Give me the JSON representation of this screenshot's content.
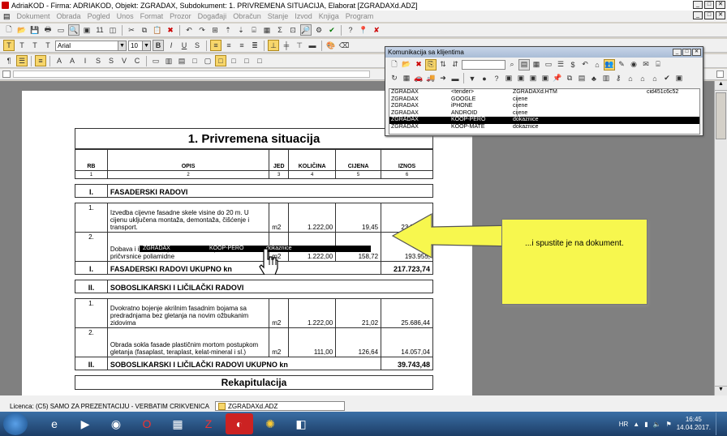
{
  "window": {
    "title": "AdriaKOD - Firma: ADRIAKOD,   Objekt: ZGRADAX,   Subdokument: 1. PRIVREMENA SITUACIJA,   Elaborat [ZGRADAXd.ADZ]"
  },
  "menu": [
    "Dokument",
    "Obrada",
    "Pogled",
    "Unos",
    "Format",
    "Prozor",
    "Događaji",
    "Obračun",
    "Stanje",
    "Izvod",
    "Knjiga",
    "Program"
  ],
  "format_toolbar": {
    "style_buttons": [
      "T",
      "T",
      "T",
      "T"
    ],
    "font": "Arial",
    "size": "10",
    "bold": "B",
    "italic": "I",
    "underline": "U",
    "strike": "S"
  },
  "document": {
    "title": "1. Privremena situacija",
    "columns": [
      "RB",
      "OPIS",
      "JED",
      "KOLIČINA",
      "CIJENA",
      "IZNOS"
    ],
    "col_numbers": [
      "1",
      "2",
      "3",
      "4",
      "5",
      "6"
    ],
    "sections": [
      {
        "num": "I.",
        "name": "FASADERSKI RADOVI",
        "items": [
          {
            "rb": "1.",
            "opis": "Izvedba cijevne fasadne skele visine do 20 m. U cijenu uključena montaža, demontaža, čišćenje i transport.",
            "jed": "m2",
            "kolicina": "1.222,00",
            "cijena": "19,45",
            "iznos": "23.767,90"
          },
          {
            "rb": "2.",
            "opis": "Dobava i izvedba toplinske fasade tipa XYZ-TERM... pričvrsnice poliamidne",
            "jed": "m2",
            "kolicina": "1.222,00",
            "cijena": "158,72",
            "iznos": "193.955,"
          }
        ],
        "total_label": "FASADERSKI RADOVI UKUPNO kn",
        "total": "217.723,74"
      },
      {
        "num": "II.",
        "name": "SOBOSLIKARSKI I LIČILAČKI RADOVI",
        "items": [
          {
            "rb": "1.",
            "opis": "Dvokratno bojenje akrilnim fasadnim bojama sa predradnjama bez gletanja na novim ožbukanim zidovima",
            "jed": "m2",
            "kolicina": "1.222,00",
            "cijena": "21,02",
            "iznos": "25.686,44"
          },
          {
            "rb": "2.",
            "opis": "Obrada sokla fasade plastičnim mortom postupkom gletanja (fasaplast, teraplast, kelat-mineral i sl.)",
            "jed": "m2",
            "kolicina": "111,00",
            "cijena": "126,64",
            "iznos": "14.057,04"
          }
        ],
        "total_label": "SOBOSLIKARSKI I LIČILAČKI RADOVI UKUPNO kn",
        "total": "39.743,48"
      }
    ],
    "next_heading_partial": "Rekapitulacija"
  },
  "comm_window": {
    "title": "Komunikacija sa klijentima",
    "rows": [
      {
        "c1": "ZGRADAX",
        "c2": "<tender>",
        "c3": "ZGRADAXd.HTM",
        "c4": "cid451c6c52"
      },
      {
        "c1": "ZGRADAX",
        "c2": "GOOGLE",
        "c3": "cijene",
        "c4": ""
      },
      {
        "c1": "ZGRADAX",
        "c2": "iPHONE",
        "c3": "cijene",
        "c4": ""
      },
      {
        "c1": "ZGRADAX",
        "c2": "ANDROID",
        "c3": "cijene",
        "c4": ""
      },
      {
        "c1": "ZGRADAX",
        "c2": "KOOP-PERO",
        "c3": "dokaznice",
        "c4": ""
      },
      {
        "c1": "ZGRADAX",
        "c2": "KOOP-MATE",
        "c3": "dokaznice",
        "c4": ""
      }
    ],
    "selected_index": 4
  },
  "drag_row": {
    "c1": "ZGRADAX",
    "c2": "KOOP-PERO",
    "c3": "dokaznice"
  },
  "callout": {
    "text": "...i spustite je na dokument."
  },
  "statusbar": {
    "licence": "Licenca:  (C5) SAMO ZA PREZENTACIJU - VERBATIM CRIKVENICA",
    "doc_tab": "ZGRADAXd.ADZ"
  },
  "tray": {
    "lang": "HR",
    "time": "16:45",
    "date": "14.04.2017."
  }
}
